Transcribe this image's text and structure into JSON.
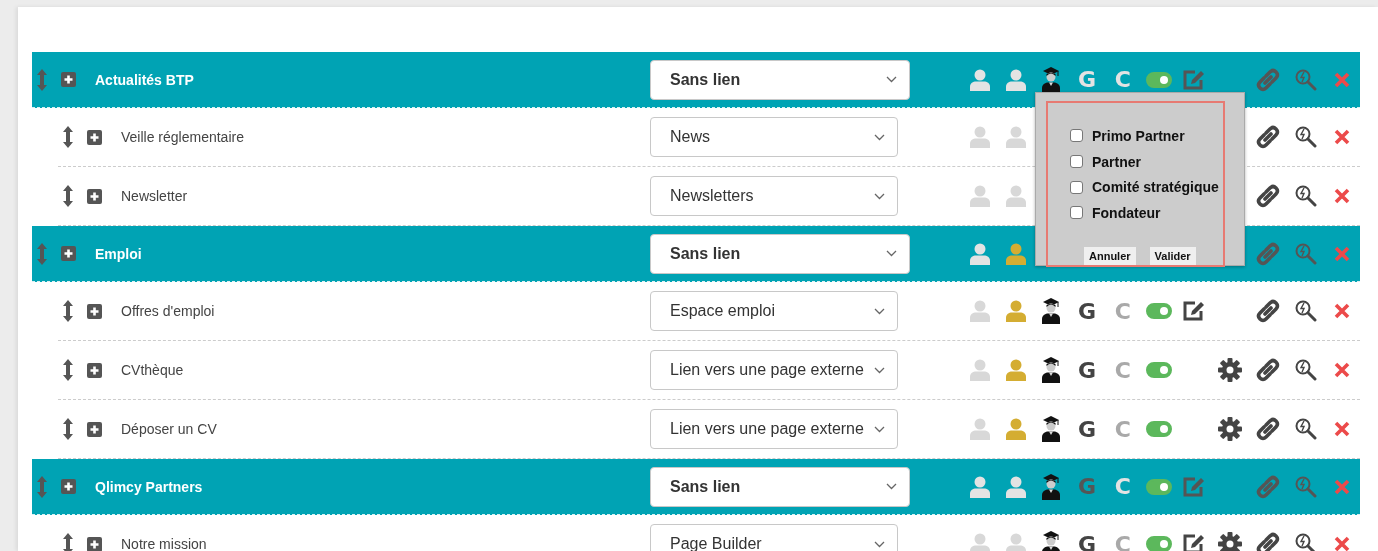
{
  "rows": [
    {
      "kind": "section",
      "label": "Actualités BTP",
      "link_type": "Sans lien",
      "audience": [
        {
          "active": false
        },
        {
          "active": false
        }
      ],
      "graduate": true,
      "g": {
        "text": "G",
        "on": false
      },
      "c": {
        "text": "C",
        "on": false
      },
      "enabled": true,
      "editable": true,
      "settings": false
    },
    {
      "kind": "item",
      "label": "Veille réglementaire",
      "link_type": "News",
      "audience": [
        {
          "active": false
        },
        {
          "active": false
        }
      ]
    },
    {
      "kind": "item",
      "label": "Newsletter",
      "link_type": "Newsletters",
      "audience": [
        {
          "active": false
        },
        {
          "active": false
        }
      ]
    },
    {
      "kind": "section",
      "label": "Emploi",
      "link_type": "Sans lien",
      "audience": [
        {
          "active": false
        },
        {
          "active": true
        }
      ]
    },
    {
      "kind": "item",
      "label": "Offres d'emploi",
      "link_type": "Espace emploi",
      "audience": [
        {
          "active": false
        },
        {
          "active": true
        }
      ],
      "graduate": true,
      "g": {
        "text": "G",
        "on": true
      },
      "c": {
        "text": "C",
        "on": false
      },
      "enabled": true,
      "editable": true,
      "settings": false
    },
    {
      "kind": "item",
      "label": "CVthèque",
      "link_type": "Lien vers une page externe",
      "audience": [
        {
          "active": false
        },
        {
          "active": true
        }
      ],
      "graduate": true,
      "g": {
        "text": "G",
        "on": true
      },
      "c": {
        "text": "C",
        "on": false
      },
      "enabled": true,
      "editable": false,
      "settings": true
    },
    {
      "kind": "item",
      "label": "Déposer un CV",
      "link_type": "Lien vers une page externe",
      "audience": [
        {
          "active": false
        },
        {
          "active": true
        }
      ],
      "graduate": true,
      "g": {
        "text": "G",
        "on": true
      },
      "c": {
        "text": "C",
        "on": false
      },
      "enabled": true,
      "editable": false,
      "settings": true
    },
    {
      "kind": "section",
      "label": "Qlimcy Partners",
      "link_type": "Sans lien",
      "audience": [
        {
          "active": false
        },
        {
          "active": false
        }
      ],
      "graduate": true,
      "g": {
        "text": "G",
        "on": true
      },
      "c": {
        "text": "C",
        "on": false
      },
      "enabled": true,
      "editable": true,
      "settings": false
    },
    {
      "kind": "item",
      "label": "Notre mission",
      "link_type": "Page Builder",
      "audience": [
        {
          "active": false
        },
        {
          "active": false
        }
      ],
      "graduate": true,
      "g": {
        "text": "G",
        "on": true
      },
      "c": {
        "text": "C",
        "on": false
      },
      "enabled": true,
      "editable": true,
      "settings": true
    }
  ],
  "popup": {
    "options": [
      {
        "label": "Primo Partner",
        "checked": false
      },
      {
        "label": "Partner",
        "checked": false
      },
      {
        "label": "Comité stratégique",
        "checked": false
      },
      {
        "label": "Fondateur",
        "checked": false
      }
    ],
    "buttons": [
      "Annuler",
      "Valider"
    ]
  }
}
